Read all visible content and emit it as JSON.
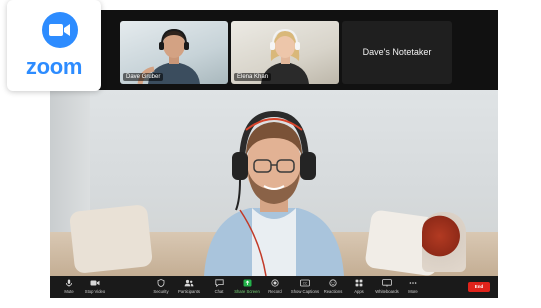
{
  "app": {
    "logo_text": "zoom",
    "brand_color": "#2d8cff"
  },
  "gallery": {
    "participants": [
      {
        "name": "Dave Gruber",
        "kind": "video"
      },
      {
        "name": "Elena Khan",
        "kind": "video"
      },
      {
        "name": "Dave's Notetaker",
        "kind": "name-only"
      }
    ]
  },
  "toolbar": {
    "items": [
      {
        "label": "Mute",
        "icon": "microphone-icon"
      },
      {
        "label": "Stop Video",
        "icon": "video-camera-icon"
      },
      {
        "label": "Security",
        "icon": "shield-icon"
      },
      {
        "label": "Participants",
        "icon": "participants-icon"
      },
      {
        "label": "Chat",
        "icon": "chat-icon"
      },
      {
        "label": "Share Screen",
        "icon": "share-screen-icon"
      },
      {
        "label": "Record",
        "icon": "record-icon"
      },
      {
        "label": "Show Captions",
        "icon": "captions-icon"
      },
      {
        "label": "Reactions",
        "icon": "reactions-icon"
      },
      {
        "label": "Apps",
        "icon": "apps-icon"
      },
      {
        "label": "Whiteboards",
        "icon": "whiteboard-icon"
      },
      {
        "label": "More",
        "icon": "more-icon"
      }
    ],
    "end_label": "End",
    "end_color": "#e0231b",
    "share_color": "#7dd87d"
  }
}
